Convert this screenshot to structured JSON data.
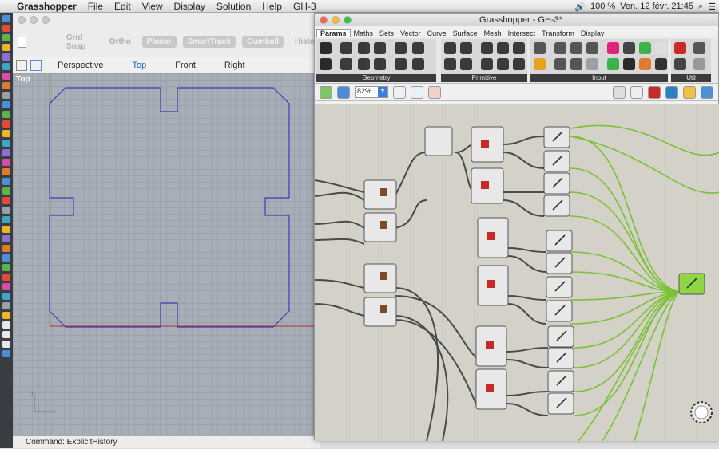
{
  "menubar": {
    "app": "Grasshopper",
    "items": [
      "File",
      "Edit",
      "View",
      "Display",
      "Solution",
      "Help",
      "GH-3"
    ],
    "battery": "100 %",
    "clock": "Ven. 12 févr. 21:45"
  },
  "rhino": {
    "snaps": [
      "Grid Snap",
      "Ortho",
      "Planar",
      "SmartTrack",
      "Gumball",
      "Histo"
    ],
    "views": [
      "Perspective",
      "Top",
      "Front",
      "Right"
    ],
    "active_view": "Top",
    "viewport_label": "Top",
    "command": "Command: ExplicitHistory"
  },
  "gh": {
    "title": "Grasshopper - GH-3*",
    "tabs": [
      "Params",
      "Maths",
      "Sets",
      "Vector",
      "Curve",
      "Surface",
      "Mesh",
      "Intersect",
      "Transform",
      "Display"
    ],
    "active_tab": "Params",
    "groups": [
      "Geometry",
      "Primitive",
      "Input",
      "Util"
    ],
    "zoom": "82%"
  },
  "colors": {
    "accent": "#1a62c5",
    "wire_green": "#79c234",
    "outline_blue": "#3d3ab0",
    "node_green": "#8fd642"
  }
}
